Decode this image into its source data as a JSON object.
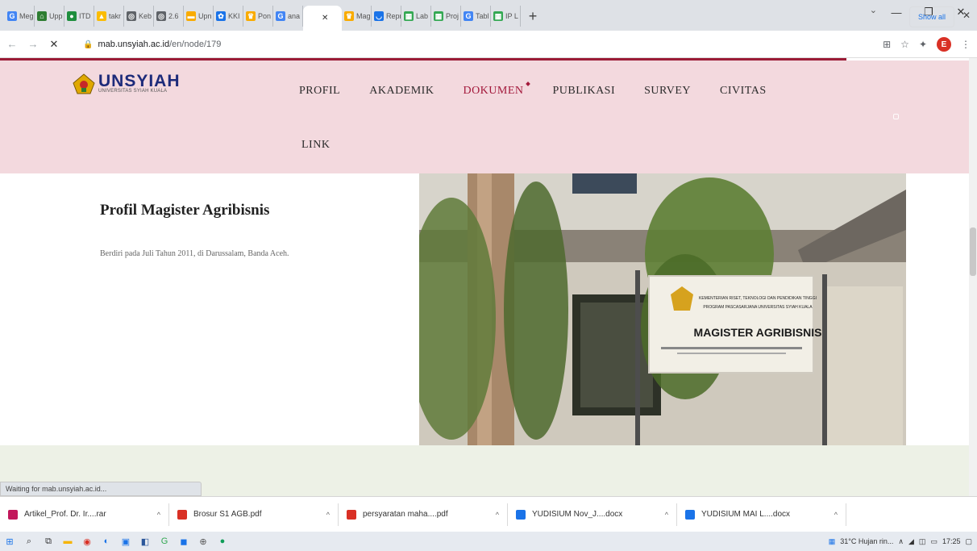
{
  "browser": {
    "tabs": [
      {
        "label": "Meg",
        "fav_color": "#4285f4",
        "fav_glyph": "G"
      },
      {
        "label": "Upp",
        "fav_color": "#2e7d32",
        "fav_glyph": "⌂"
      },
      {
        "label": "ITD",
        "fav_color": "#1e8e3e",
        "fav_glyph": "●"
      },
      {
        "label": "takr",
        "fav_color": "#fbbc04",
        "fav_glyph": "▲"
      },
      {
        "label": "Keb",
        "fav_color": "#5f6368",
        "fav_glyph": "◎"
      },
      {
        "label": "2.6",
        "fav_color": "#5f6368",
        "fav_glyph": "◎"
      },
      {
        "label": "Upn",
        "fav_color": "#f9ab00",
        "fav_glyph": "▬"
      },
      {
        "label": "KKI",
        "fav_color": "#1a73e8",
        "fav_glyph": "✿"
      },
      {
        "label": "Pon",
        "fav_color": "#f9ab00",
        "fav_glyph": "♛"
      },
      {
        "label": "ana",
        "fav_color": "#4285f4",
        "fav_glyph": "G"
      },
      {
        "label": "",
        "fav_color": "#ffffff",
        "fav_glyph": "",
        "active": true
      },
      {
        "label": "Mag",
        "fav_color": "#f9ab00",
        "fav_glyph": "♛"
      },
      {
        "label": "Repr",
        "fav_color": "#1a73e8",
        "fav_glyph": "◡"
      },
      {
        "label": "Lab",
        "fav_color": "#34a853",
        "fav_glyph": "▦"
      },
      {
        "label": "Proj",
        "fav_color": "#34a853",
        "fav_glyph": "▦"
      },
      {
        "label": "Tabl",
        "fav_color": "#4285f4",
        "fav_glyph": "G"
      },
      {
        "label": "IP L",
        "fav_color": "#34a853",
        "fav_glyph": "▦"
      }
    ],
    "new_tab_label": "+",
    "url_host": "mab.unsyiah.ac.id",
    "url_path": "/en/node/179",
    "profile_initial": "E",
    "status_text": "Waiting for mab.unsyiah.ac.id..."
  },
  "site": {
    "logo_name": "UNSYIAH",
    "logo_sub": "UNIVERSITAS SYIAH KUALA",
    "menu": [
      "PROFIL",
      "AKADEMIK",
      "DOKUMEN",
      "PUBLIKASI",
      "SURVEY",
      "CIVITAS"
    ],
    "menu_second_row": "LINK",
    "accent": "#a3193b",
    "header_bg": "#f3d9de"
  },
  "content": {
    "title": "Profil Magister Agribisnis",
    "description": "Berdiri pada Juli Tahun 2011, di Darussalam, Banda Aceh.",
    "sign_title": "MAGISTER AGRIBISNIS",
    "sign_line1": "KEMENTERIAN RISET, TEKNOLOGI DAN PENDIDIKAN TINGGI",
    "sign_line2": "PROGRAM PASCASARJANA UNIVERSITAS SYIAH KUALA"
  },
  "downloads": {
    "items": [
      {
        "name": "Artikel_Prof. Dr. Ir....rar",
        "color": "#c2185b"
      },
      {
        "name": "Brosur S1 AGB.pdf",
        "color": "#d93025"
      },
      {
        "name": "persyaratan maha....pdf",
        "color": "#d93025"
      },
      {
        "name": "YUDISIUM Nov_J....docx",
        "color": "#1a73e8"
      },
      {
        "name": "YUDISIUM MAI L....docx",
        "color": "#1a73e8"
      }
    ],
    "show_all": "Show all"
  },
  "taskbar": {
    "weather": "31°C  Hujan rin...",
    "time": "17:25"
  }
}
